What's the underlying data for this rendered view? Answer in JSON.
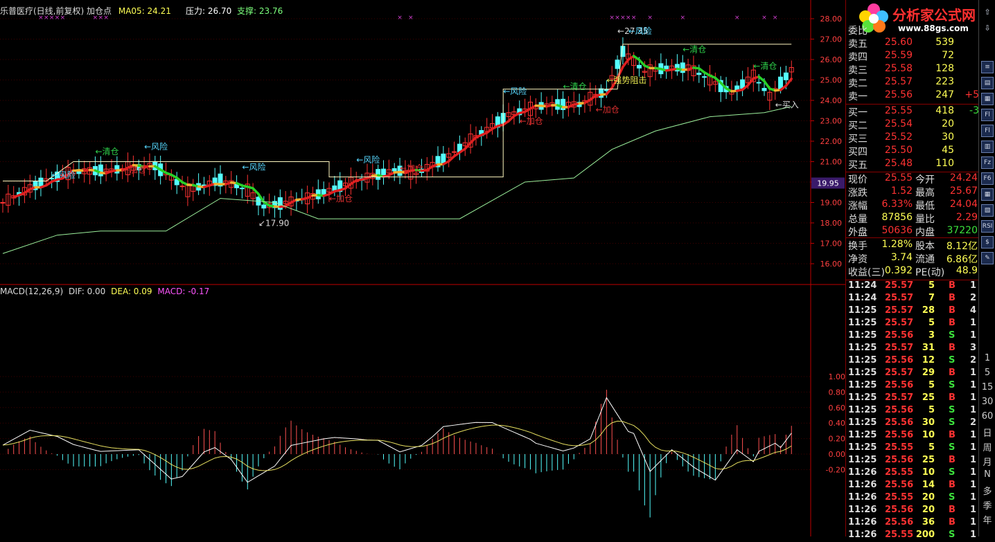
{
  "header": {
    "stock_name": "乐普医疗(日线,前复权)",
    "indicator_name": "加仓点",
    "ma_label": "MA05: 24.21",
    "resistance_label": "压力: 26.70",
    "support_label": "支撑: 23.76"
  },
  "macd_header": {
    "title": "MACD(12,26,9)",
    "dif": "DIF: 0.00",
    "dea": "DEA: 0.09",
    "macd": "MACD: -0.17"
  },
  "price_axis": [
    "28.00",
    "27.00",
    "26.00",
    "25.00",
    "24.00",
    "23.00",
    "22.00",
    "21.00",
    "20.00",
    "19.00",
    "18.00",
    "17.00",
    "16.00"
  ],
  "price_axis_values": [
    28,
    27,
    26,
    25,
    24,
    23,
    22,
    21,
    20,
    19,
    18,
    17,
    16
  ],
  "current_price_tag": "19.95",
  "macd_axis": [
    "1.00",
    "0.80",
    "0.60",
    "0.40",
    "0.20",
    "0.00",
    "-0.20"
  ],
  "macd_axis_values": [
    1.0,
    0.8,
    0.6,
    0.4,
    0.2,
    0.0,
    -0.2
  ],
  "annotations": [
    {
      "text": "←风险",
      "color": "#58d8ff",
      "price": 20.2,
      "bar": 9
    },
    {
      "text": "←清仓",
      "color": "#2ed04a",
      "price": 21.35,
      "bar": 17
    },
    {
      "text": "←风险",
      "color": "#58d8ff",
      "price": 21.6,
      "bar": 26
    },
    {
      "text": "←加仓",
      "color": "#e03030",
      "price": 20.45,
      "bar": 22
    },
    {
      "text": "←风险",
      "color": "#58d8ff",
      "price": 20.6,
      "bar": 44
    },
    {
      "text": "↙17.90",
      "color": "#d8d8d8",
      "price": 17.85,
      "bar": 47
    },
    {
      "text": "←加仓",
      "color": "#e03030",
      "price": 19.05,
      "bar": 60
    },
    {
      "text": "←风险",
      "color": "#58d8ff",
      "price": 20.95,
      "bar": 65
    },
    {
      "text": "←加仓",
      "color": "#e03030",
      "price": 20.55,
      "bar": 73
    },
    {
      "text": "←风险",
      "color": "#58d8ff",
      "price": 24.3,
      "bar": 92
    },
    {
      "text": "←清仓",
      "color": "#2ed04a",
      "price": 24.55,
      "bar": 103
    },
    {
      "text": "←加仓",
      "color": "#e03030",
      "price": 22.85,
      "bar": 95
    },
    {
      "text": "←加仓",
      "color": "#e03030",
      "price": 23.4,
      "bar": 109
    },
    {
      "text": "←强势阻击",
      "color": "#e8e850",
      "price": 24.85,
      "bar": 111
    },
    {
      "text": "←27.35",
      "color": "#d8d8d8",
      "price": 27.25,
      "bar": 113
    },
    {
      "text": "←风险",
      "color": "#58d8ff",
      "price": 27.25,
      "bar": 115
    },
    {
      "text": "←清仓",
      "color": "#2ed04a",
      "price": 26.35,
      "bar": 125
    },
    {
      "text": "←清仓",
      "color": "#2ed04a",
      "price": 25.55,
      "bar": 138
    },
    {
      "text": "←买入",
      "color": "#d8d8d8",
      "price": 23.65,
      "bar": 142
    }
  ],
  "quote": {
    "title": "委比",
    "sell": [
      {
        "label": "卖五",
        "price": "25.60",
        "vol": "539"
      },
      {
        "label": "卖四",
        "price": "25.59",
        "vol": "72"
      },
      {
        "label": "卖三",
        "price": "25.58",
        "vol": "128"
      },
      {
        "label": "卖二",
        "price": "25.57",
        "vol": "223"
      },
      {
        "label": "卖一",
        "price": "25.56",
        "vol": "247",
        "chg": "+5"
      }
    ],
    "buy": [
      {
        "label": "买一",
        "price": "25.55",
        "vol": "418",
        "chg": "-3"
      },
      {
        "label": "买二",
        "price": "25.54",
        "vol": "20"
      },
      {
        "label": "买三",
        "price": "25.52",
        "vol": "30"
      },
      {
        "label": "买四",
        "price": "25.50",
        "vol": "45"
      },
      {
        "label": "买五",
        "price": "25.48",
        "vol": "110"
      }
    ],
    "stats": [
      {
        "l1": "现价",
        "v1": "25.55",
        "l2": "今开",
        "v2": "24.24"
      },
      {
        "l1": "涨跌",
        "v1": "1.52",
        "l2": "最高",
        "v2": "25.67"
      },
      {
        "l1": "涨幅",
        "v1": "6.33%",
        "l2": "最低",
        "v2": "24.04"
      },
      {
        "l1": "总量",
        "v1": "87856",
        "l2": "量比",
        "v2": "2.29"
      },
      {
        "l1": "外盘",
        "v1": "50636",
        "l2": "内盘",
        "v2": "37220"
      }
    ],
    "stats2": [
      {
        "l1": "换手",
        "v1": "1.28%",
        "l2": "股本",
        "v2": "8.12亿"
      },
      {
        "l1": "净资",
        "v1": "3.74",
        "l2": "流通",
        "v2": "6.86亿"
      },
      {
        "l1": "收益(三)",
        "v1": "0.392",
        "l2": "PE(动)",
        "v2": "48.9"
      }
    ],
    "ticks": [
      {
        "t": "11:24",
        "p": "25.57",
        "v": "5",
        "bs": "B",
        "n": "1"
      },
      {
        "t": "11:24",
        "p": "25.57",
        "v": "7",
        "bs": "B",
        "n": "2"
      },
      {
        "t": "11:25",
        "p": "25.57",
        "v": "28",
        "bs": "B",
        "n": "4"
      },
      {
        "t": "11:25",
        "p": "25.57",
        "v": "5",
        "bs": "B",
        "n": "1"
      },
      {
        "t": "11:25",
        "p": "25.56",
        "v": "3",
        "bs": "S",
        "n": "1"
      },
      {
        "t": "11:25",
        "p": "25.57",
        "v": "31",
        "bs": "B",
        "n": "3"
      },
      {
        "t": "11:25",
        "p": "25.56",
        "v": "12",
        "bs": "S",
        "n": "2"
      },
      {
        "t": "11:25",
        "p": "25.57",
        "v": "29",
        "bs": "B",
        "n": "1"
      },
      {
        "t": "11:25",
        "p": "25.56",
        "v": "5",
        "bs": "S",
        "n": "1"
      },
      {
        "t": "11:25",
        "p": "25.57",
        "v": "25",
        "bs": "B",
        "n": "1"
      },
      {
        "t": "11:25",
        "p": "25.56",
        "v": "5",
        "bs": "S",
        "n": "1"
      },
      {
        "t": "11:25",
        "p": "25.56",
        "v": "30",
        "bs": "S",
        "n": "2"
      },
      {
        "t": "11:25",
        "p": "25.56",
        "v": "10",
        "bs": "B",
        "n": "1"
      },
      {
        "t": "11:25",
        "p": "25.55",
        "v": "5",
        "bs": "S",
        "n": "1"
      },
      {
        "t": "11:25",
        "p": "25.56",
        "v": "25",
        "bs": "B",
        "n": "1"
      },
      {
        "t": "11:26",
        "p": "25.55",
        "v": "10",
        "bs": "S",
        "n": "1"
      },
      {
        "t": "11:26",
        "p": "25.56",
        "v": "14",
        "bs": "B",
        "n": "1"
      },
      {
        "t": "11:26",
        "p": "25.55",
        "v": "20",
        "bs": "S",
        "n": "1"
      },
      {
        "t": "11:26",
        "p": "25.56",
        "v": "20",
        "bs": "B",
        "n": "1"
      },
      {
        "t": "11:26",
        "p": "25.56",
        "v": "36",
        "bs": "B",
        "n": "1"
      },
      {
        "t": "11:26",
        "p": "25.55",
        "v": "200",
        "bs": "S",
        "n": "1"
      }
    ]
  },
  "toolbar": {
    "icons": [
      "up-arrow-icon",
      "down-arrow-icon",
      "list-icon",
      "table-icon",
      "grid-icon",
      "f10-icon",
      "fl-icon",
      "chart-icon",
      "fz-icon",
      "f6-icon",
      "grid2-icon",
      "layout-icon",
      "rsi-icon",
      "dollar-icon",
      "edit-icon"
    ],
    "icon_labels": [
      "⇧",
      "⇩",
      "≡",
      "▤",
      "▦",
      "Fl",
      "Fl",
      "▥",
      "Fz",
      "F6",
      "▦",
      "▧",
      "RSI",
      "$",
      "✎"
    ],
    "periods": [
      "1",
      "5",
      "15",
      "30",
      "60",
      "日",
      "周",
      "月",
      "N",
      "多",
      "季",
      "年"
    ]
  },
  "logo": {
    "brand": "分析家公式网",
    "url": "www.88gs.com"
  },
  "colors": {
    "up": "#ff3232",
    "down": "#54ffff",
    "axis": "#c00000",
    "grid": "#400000"
  }
}
